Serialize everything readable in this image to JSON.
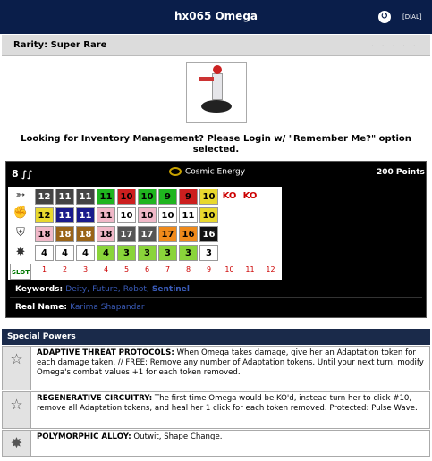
{
  "header": {
    "title": "hx065 Omega",
    "dial_label": "[DIAL]"
  },
  "rarity": {
    "label": "Rarity: Super Rare",
    "dots": ". . . . ."
  },
  "notice": "Looking for Inventory Management? Please Login w/ \"Remember Me?\" option selected.",
  "dial": {
    "point_cost_symbol": "8",
    "team_ability": "Cosmic Energy",
    "points": "200 Points",
    "slot_label": "SLOT",
    "stat_icons": [
      "speed-icon",
      "attack-icon",
      "defense-icon",
      "damage-icon"
    ],
    "rows": {
      "speed": [
        {
          "v": "12",
          "c": "#444444",
          "t": "#ffffff"
        },
        {
          "v": "11",
          "c": "#444444",
          "t": "#ffffff"
        },
        {
          "v": "11",
          "c": "#444444",
          "t": "#ffffff"
        },
        {
          "v": "11",
          "c": "#1fb51f",
          "t": "#000000"
        },
        {
          "v": "10",
          "c": "#cc1f1f",
          "t": "#000000"
        },
        {
          "v": "10",
          "c": "#1fb51f",
          "t": "#000000"
        },
        {
          "v": "9",
          "c": "#1fb51f",
          "t": "#000000"
        },
        {
          "v": "9",
          "c": "#cc1f1f",
          "t": "#000000"
        },
        {
          "v": "10",
          "c": "#e8d82e",
          "t": "#000000"
        }
      ],
      "attack": [
        {
          "v": "12",
          "c": "#e8d82e",
          "t": "#000000"
        },
        {
          "v": "11",
          "c": "#1a1a8c",
          "t": "#ffffff"
        },
        {
          "v": "11",
          "c": "#1a1a8c",
          "t": "#ffffff"
        },
        {
          "v": "11",
          "c": "#f0b8c8",
          "t": "#000000"
        },
        {
          "v": "10",
          "c": "#ffffff",
          "t": "#000000"
        },
        {
          "v": "10",
          "c": "#f0b8c8",
          "t": "#000000"
        },
        {
          "v": "10",
          "c": "#ffffff",
          "t": "#000000"
        },
        {
          "v": "11",
          "c": "#ffffff",
          "t": "#000000"
        },
        {
          "v": "10",
          "c": "#e8d82e",
          "t": "#000000"
        }
      ],
      "defense": [
        {
          "v": "18",
          "c": "#f0b8c8",
          "t": "#000000"
        },
        {
          "v": "18",
          "c": "#9a6418",
          "t": "#ffffff"
        },
        {
          "v": "18",
          "c": "#9a6418",
          "t": "#ffffff"
        },
        {
          "v": "18",
          "c": "#f0b8c8",
          "t": "#000000"
        },
        {
          "v": "17",
          "c": "#555555",
          "t": "#ffffff"
        },
        {
          "v": "17",
          "c": "#555555",
          "t": "#ffffff"
        },
        {
          "v": "17",
          "c": "#f08a1a",
          "t": "#000000"
        },
        {
          "v": "16",
          "c": "#f08a1a",
          "t": "#000000"
        },
        {
          "v": "16",
          "c": "#111111",
          "t": "#ffffff"
        }
      ],
      "damage": [
        {
          "v": "4",
          "c": "#ffffff",
          "t": "#000000"
        },
        {
          "v": "4",
          "c": "#ffffff",
          "t": "#000000"
        },
        {
          "v": "4",
          "c": "#ffffff",
          "t": "#000000"
        },
        {
          "v": "4",
          "c": "#8ad43a",
          "t": "#000000"
        },
        {
          "v": "3",
          "c": "#8ad43a",
          "t": "#000000"
        },
        {
          "v": "3",
          "c": "#8ad43a",
          "t": "#000000"
        },
        {
          "v": "3",
          "c": "#8ad43a",
          "t": "#000000"
        },
        {
          "v": "3",
          "c": "#8ad43a",
          "t": "#000000"
        },
        {
          "v": "3",
          "c": "#ffffff",
          "t": "#000000"
        }
      ]
    },
    "ko_label": "KO",
    "slots": [
      "1",
      "2",
      "3",
      "4",
      "5",
      "6",
      "7",
      "8",
      "9",
      "10",
      "11",
      "12"
    ]
  },
  "keywords": {
    "label": "Keywords:",
    "values": [
      "Deity",
      "Future",
      "Robot",
      "Sentinel"
    ]
  },
  "real_name": {
    "label": "Real Name:",
    "value": "Karima Shapandar"
  },
  "special_powers": {
    "heading": "Special Powers",
    "items": [
      {
        "name": "ADAPTIVE THREAT PROTOCOLS:",
        "text": " When Omega takes damage, give her an Adaptation token for each damage taken. // FREE: Remove any number of Adaptation tokens. Until your next turn, modify Omega's combat values +1 for each token removed.",
        "icon": "star-icon"
      },
      {
        "name": "REGENERATIVE CIRCUITRY:",
        "text": " The first time Omega would be KO'd, instead turn her to click #10, remove all Adaptation tokens, and heal her 1 click for each token removed. Protected: Pulse Wave.",
        "icon": "star-icon"
      },
      {
        "name": "POLYMORPHIC ALLOY:",
        "text": " Outwit, Shape Change.",
        "icon": "burst-icon"
      }
    ]
  }
}
